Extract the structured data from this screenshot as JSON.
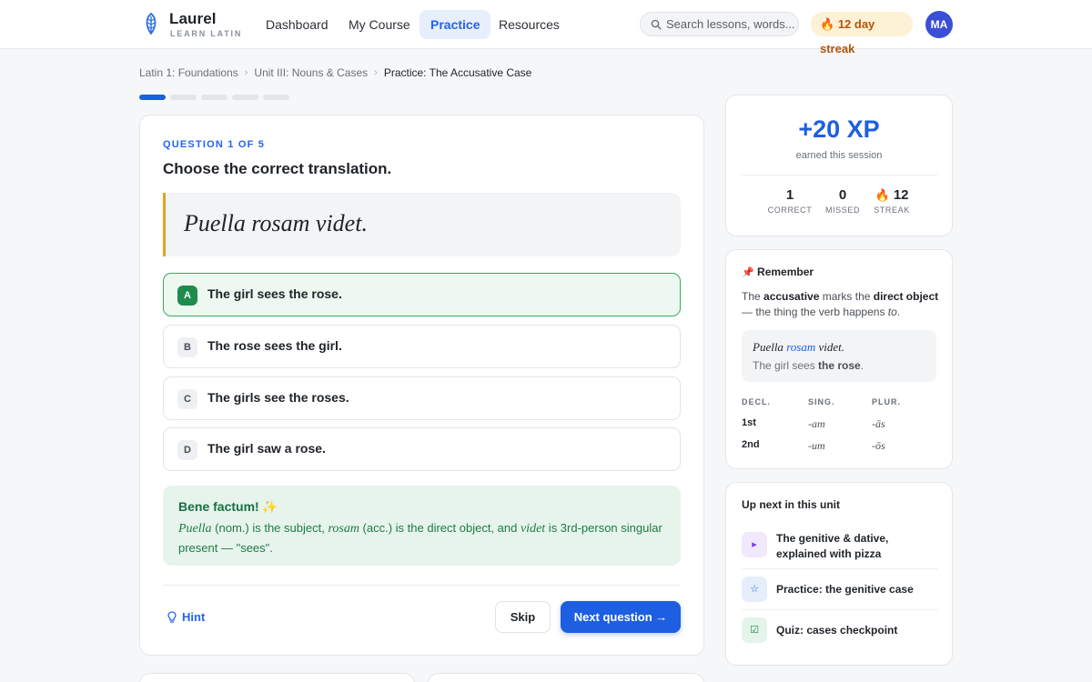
{
  "app": {
    "name": "Laurel",
    "tagline": "LEARN LATIN"
  },
  "nav": {
    "items": [
      {
        "label": "Dashboard",
        "active": false
      },
      {
        "label": "My Course",
        "active": false
      },
      {
        "label": "Practice",
        "active": true
      },
      {
        "label": "Resources",
        "active": false
      }
    ]
  },
  "search": {
    "placeholder": "Search lessons, words..."
  },
  "streak_badge": {
    "icon": "fire-icon",
    "label": "12 day streak"
  },
  "user": {
    "initials": "MA"
  },
  "breadcrumb": [
    "Latin 1: Foundations",
    "Unit III: Nouns & Cases",
    "Practice: The Accusative Case"
  ],
  "progress": {
    "total": 5,
    "completed": 1
  },
  "question": {
    "label": "QUESTION 1 OF 5",
    "prompt": "Choose the correct translation.",
    "latin": "Puella rosam videt.",
    "options": [
      {
        "key": "A",
        "text": "The girl sees the rose.",
        "selected": true
      },
      {
        "key": "B",
        "text": "The rose sees the girl.",
        "selected": false
      },
      {
        "key": "C",
        "text": "The girls see the roses.",
        "selected": false
      },
      {
        "key": "D",
        "text": "The girl saw a rose.",
        "selected": false
      }
    ]
  },
  "feedback": {
    "title": "Bene factum!",
    "sparkle": "✨",
    "word1": "Puella",
    "text1": " (nom.) is the subject, ",
    "word2": "rosam",
    "text2": " (acc.) is the direct object, and ",
    "word3": "videt",
    "text3": " is 3rd-person singular present — \"sees\"."
  },
  "actions": {
    "hint": "Hint",
    "skip": "Skip",
    "next": "Next question →"
  },
  "session": {
    "xp": "+20 XP",
    "xp_sub": "earned this session",
    "stats": [
      {
        "value": "1",
        "label": "CORRECT"
      },
      {
        "value": "0",
        "label": "MISSED"
      },
      {
        "value": "12",
        "label": "STREAK",
        "icon": "fire-icon"
      }
    ]
  },
  "remember": {
    "icon": "pushpin-icon",
    "title": "Remember",
    "body_1": "The ",
    "body_bold_1": "accusative",
    "body_2": " marks the ",
    "body_bold_2": "direct object",
    "body_3": " — the thing the verb happens ",
    "body_italic": "to",
    "body_4": ".",
    "example_word1": "Puella",
    "example_acc": "rosam",
    "example_word3": "videt.",
    "example_eng_1": "The girl sees ",
    "example_eng_bold": "the rose",
    "example_eng_2": ".",
    "table_headers": [
      "DECL.",
      "SING.",
      "PLUR."
    ],
    "table_rows": [
      {
        "decl": "1st",
        "sing": "-am",
        "plur": "-ās"
      },
      {
        "decl": "2nd",
        "sing": "-um",
        "plur": "-ōs"
      }
    ]
  },
  "up_next": {
    "title": "Up next in this unit",
    "items": [
      {
        "icon": "play-icon",
        "text": "The genitive & dative, explained with pizza",
        "color": "#f0e8fb"
      },
      {
        "icon": "star-icon",
        "text": "Practice: the genitive case",
        "color": "#e6eefc"
      },
      {
        "icon": "checkbox-icon",
        "text": "Quiz: cases checkpoint",
        "color": "#e4f4ea"
      }
    ]
  },
  "colors": {
    "accent": "#1d5fe0",
    "success": "#1f8c4e",
    "streak": "#b45309",
    "latin_border": "#e0a526"
  }
}
